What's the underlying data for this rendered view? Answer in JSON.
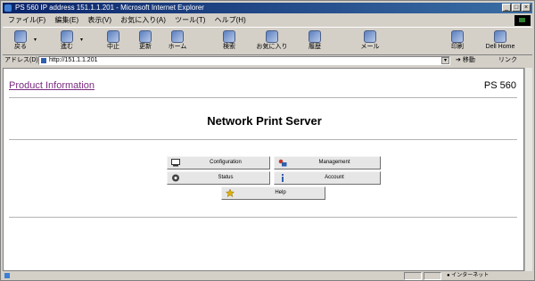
{
  "window": {
    "title": "PS 560 IP address 151.1.1.201 - Microsoft Internet Explorer"
  },
  "menu": {
    "items": [
      "ファイル(F)",
      "編集(E)",
      "表示(V)",
      "お気に入り(A)",
      "ツール(T)",
      "ヘルプ(H)"
    ]
  },
  "toolbar": {
    "buttons": [
      {
        "label": "戻る",
        "icon": "back-arrow-icon"
      },
      {
        "label": "進む",
        "icon": "forward-arrow-icon"
      },
      {
        "label": "中止",
        "icon": "stop-icon"
      },
      {
        "label": "更新",
        "icon": "refresh-icon"
      },
      {
        "label": "ホーム",
        "icon": "home-icon"
      },
      {
        "label": "検索",
        "icon": "search-icon"
      },
      {
        "label": "お気に入り",
        "icon": "favorites-icon"
      },
      {
        "label": "履歴",
        "icon": "history-icon"
      },
      {
        "label": "メール",
        "icon": "mail-icon"
      },
      {
        "label": "印刷",
        "icon": "print-icon"
      },
      {
        "label": "Dell Home",
        "icon": "dell-home-icon"
      }
    ]
  },
  "address": {
    "label": "アドレス(D)",
    "url": "http://151.1.1.201",
    "go": "移動",
    "links": "リンク"
  },
  "page": {
    "product_link": "Product Information",
    "model": "PS 560",
    "heading": "Network Print Server",
    "buttons": [
      {
        "label": "Configuration",
        "icon": "configuration-icon"
      },
      {
        "label": "Management",
        "icon": "management-icon"
      },
      {
        "label": "Status",
        "icon": "status-icon"
      },
      {
        "label": "Account",
        "icon": "account-icon"
      },
      {
        "label": "Help",
        "icon": "help-icon"
      }
    ]
  },
  "status": {
    "zone": "インターネット"
  },
  "colors": {
    "title_bar": "#0a246a",
    "link": "#7a2a80",
    "button_face": "#e6e6e6"
  }
}
